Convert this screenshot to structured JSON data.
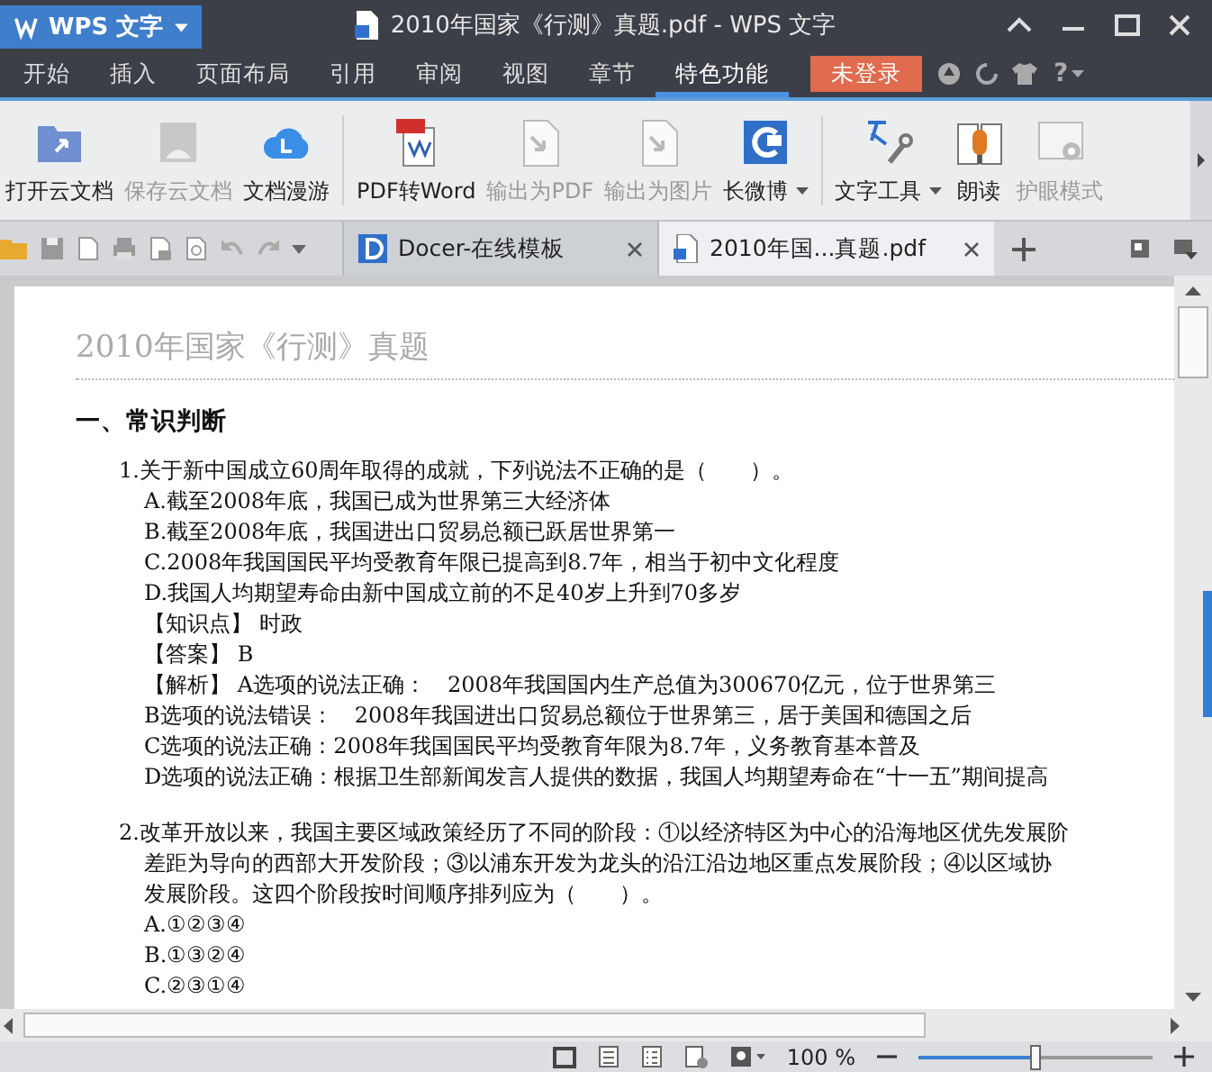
{
  "app_menu": {
    "label": "WPS 文字"
  },
  "window": {
    "title": "2010年国家《行测》真题.pdf - WPS 文字"
  },
  "menu_tabs": [
    {
      "label": "开始",
      "selected": false
    },
    {
      "label": "插入",
      "selected": false
    },
    {
      "label": "页面布局",
      "selected": false
    },
    {
      "label": "引用",
      "selected": false
    },
    {
      "label": "审阅",
      "selected": false
    },
    {
      "label": "视图",
      "selected": false
    },
    {
      "label": "章节",
      "selected": false
    },
    {
      "label": "特色功能",
      "selected": true
    }
  ],
  "login_button": {
    "label": "未登录"
  },
  "help": {
    "label": "?"
  },
  "ribbon_groups": [
    [
      {
        "label": "打开云文档",
        "disabled": false,
        "has_menu": false
      },
      {
        "label": "保存云文档",
        "disabled": true,
        "has_menu": false
      },
      {
        "label": "文档漫游",
        "disabled": false,
        "has_menu": false
      }
    ],
    [
      {
        "label": "PDF转Word",
        "disabled": false,
        "has_menu": false
      },
      {
        "label": "输出为PDF",
        "disabled": true,
        "has_menu": false
      },
      {
        "label": "输出为图片",
        "disabled": true,
        "has_menu": false
      },
      {
        "label": "长微博",
        "disabled": false,
        "has_menu": true
      }
    ],
    [
      {
        "label": "文字工具",
        "disabled": false,
        "has_menu": true
      },
      {
        "label": "朗读",
        "disabled": false,
        "has_menu": false
      },
      {
        "label": "护眼模式",
        "disabled": true,
        "has_menu": false
      }
    ]
  ],
  "doc_tabs": [
    {
      "label": "Docer-在线模板",
      "selected": false
    },
    {
      "label": "2010年国...真题.pdf",
      "selected": true
    }
  ],
  "document": {
    "title": "2010年国家《行测》真题",
    "heading": "一、常识判断",
    "questions": [
      {
        "stem_lines": [
          "1.关于新中国成立60周年取得的成就，下列说法不正确的是（　　）。"
        ],
        "lines": [
          "A.截至2008年底，我国已成为世界第三大经济体",
          "B.截至2008年底，我国进出口贸易总额已跃居世界第一",
          "C.2008年我国国民平均受教育年限已提高到8.7年，相当于初中文化程度",
          "D.我国人均期望寿命由新中国成立前的不足40岁上升到70多岁",
          "【知识点】 时政",
          "【答案】 B",
          "【解析】 A选项的说法正确：　2008年我国国内生产总值为300670亿元，位于世界第三",
          "B选项的说法错误：　2008年我国进出口贸易总额位于世界第三，居于美国和德国之后",
          "C选项的说法正确：2008年我国国民平均受教育年限为8.7年，义务教育基本普及",
          "D选项的说法正确：根据卫生部新闻发言人提供的数据，我国人均期望寿命在“十一五”期间提高"
        ]
      },
      {
        "stem_lines": [
          "2.改革开放以来，我国主要区域政策经历了不同的阶段：①以经济特区为中心的沿海地区优先发展阶",
          "差距为导向的西部大开发阶段；③以浦东开发为龙头的沿江沿边地区重点发展阶段；④以区域协",
          "发展阶段。这四个阶段按时间顺序排列应为（　　）。"
        ],
        "lines": [
          "A.①②③④",
          "B.①③②④",
          "C.②③①④"
        ]
      }
    ]
  },
  "zoom": {
    "reading": "100 %",
    "level": 0.5
  }
}
